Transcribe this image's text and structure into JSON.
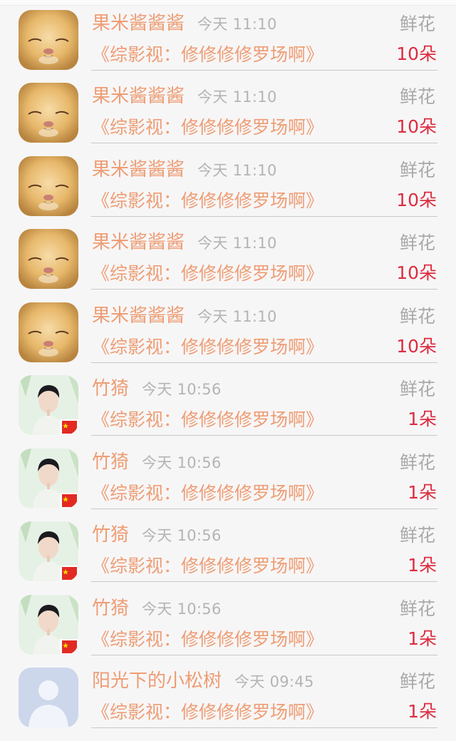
{
  "records": [
    {
      "name": "果米酱酱酱",
      "time": "今天 11:10",
      "title": "《综影视：修修修修罗场啊》",
      "gift": "鲜花",
      "count": "10朵",
      "avatar": "cat-photo"
    },
    {
      "name": "果米酱酱酱",
      "time": "今天 11:10",
      "title": "《综影视：修修修修罗场啊》",
      "gift": "鲜花",
      "count": "10朵",
      "avatar": "cat-photo"
    },
    {
      "name": "果米酱酱酱",
      "time": "今天 11:10",
      "title": "《综影视：修修修修罗场啊》",
      "gift": "鲜花",
      "count": "10朵",
      "avatar": "cat-photo"
    },
    {
      "name": "果米酱酱酱",
      "time": "今天 11:10",
      "title": "《综影视：修修修修罗场啊》",
      "gift": "鲜花",
      "count": "10朵",
      "avatar": "cat-photo"
    },
    {
      "name": "果米酱酱酱",
      "time": "今天 11:10",
      "title": "《综影视：修修修修罗场啊》",
      "gift": "鲜花",
      "count": "10朵",
      "avatar": "cat-photo"
    },
    {
      "name": "竹猗",
      "time": "今天 10:56",
      "title": "《综影视：修修修修罗场啊》",
      "gift": "鲜花",
      "count": "1朵",
      "avatar": "person-photo-flag"
    },
    {
      "name": "竹猗",
      "time": "今天 10:56",
      "title": "《综影视：修修修修罗场啊》",
      "gift": "鲜花",
      "count": "1朵",
      "avatar": "person-photo-flag"
    },
    {
      "name": "竹猗",
      "time": "今天 10:56",
      "title": "《综影视：修修修修罗场啊》",
      "gift": "鲜花",
      "count": "1朵",
      "avatar": "person-photo-flag"
    },
    {
      "name": "竹猗",
      "time": "今天 10:56",
      "title": "《综影视：修修修修罗场啊》",
      "gift": "鲜花",
      "count": "1朵",
      "avatar": "person-photo-flag"
    },
    {
      "name": "阳光下的小松树",
      "time": "今天 09:45",
      "title": "《综影视：修修修修罗场啊》",
      "gift": "鲜花",
      "count": "1朵",
      "avatar": "default-user-avatar"
    }
  ],
  "colors": {
    "name": "#ee9d74",
    "time": "#b4b4b4",
    "gift": "#a9a9a9",
    "count": "#dc2d3f",
    "background": "#f7f6f7"
  }
}
